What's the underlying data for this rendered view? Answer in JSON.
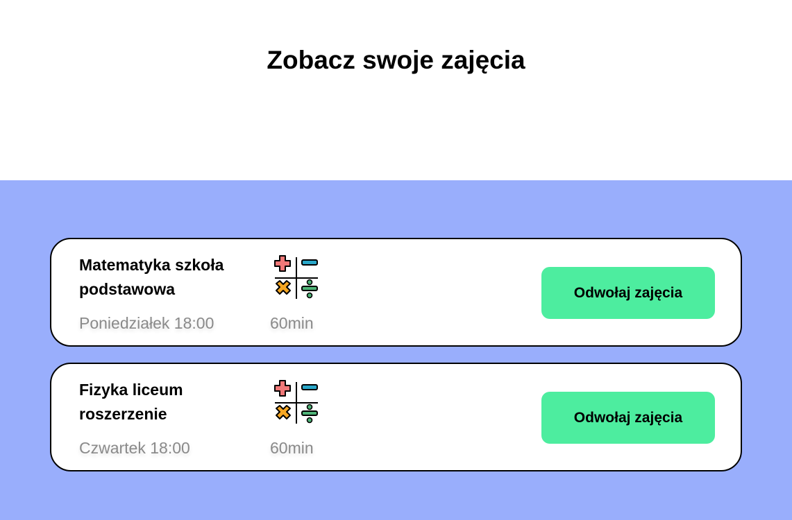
{
  "page": {
    "title": "Zobacz swoje zajęcia"
  },
  "colors": {
    "section_background": "#99aefc",
    "button_background": "#4ded9f",
    "card_background": "#ffffff",
    "muted_text": "#8a8a8a"
  },
  "classes": [
    {
      "title": "Matematyka szkoła podstawowa",
      "day_time": "Poniedziałek 18:00",
      "duration": "60min",
      "icon": "math-operations-icon",
      "button_label": "Odwołaj zajęcia"
    },
    {
      "title": "Fizyka liceum roszerzenie",
      "day_time": "Czwartek 18:00",
      "duration": "60min",
      "icon": "math-operations-icon",
      "button_label": "Odwołaj zajęcia"
    }
  ]
}
